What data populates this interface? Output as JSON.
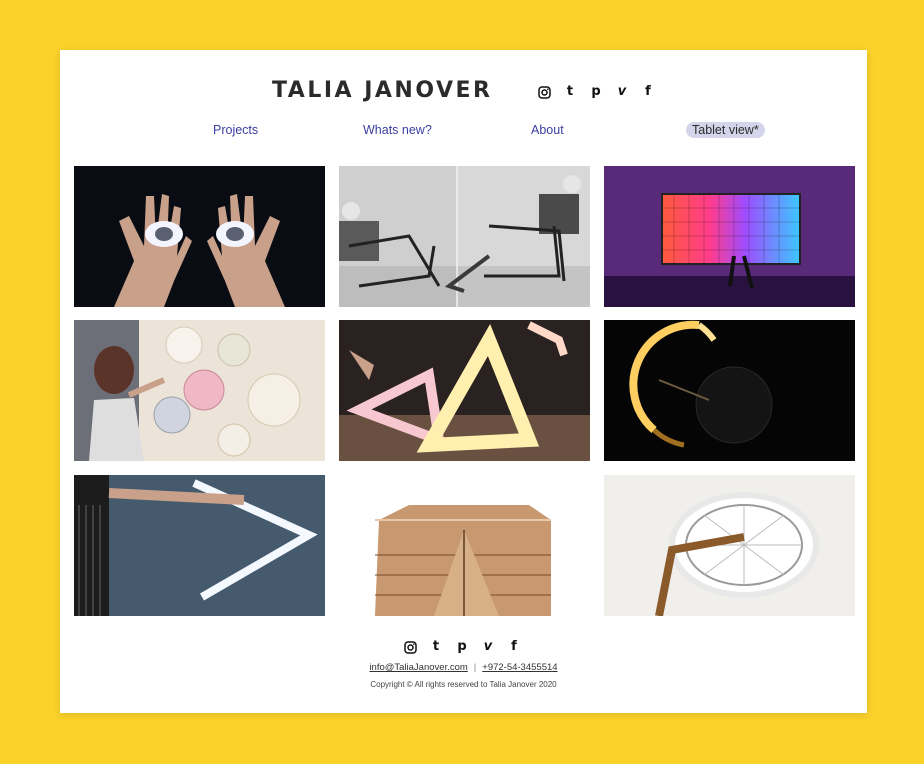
{
  "header": {
    "title": "TALIA JANOVER"
  },
  "social": {
    "icons": [
      "instagram-icon",
      "tumblr-icon",
      "pinterest-icon",
      "vimeo-icon",
      "facebook-icon"
    ],
    "glyphs": {
      "tumblr": "t",
      "pinterest": "p",
      "vimeo": "v",
      "facebook": "f"
    }
  },
  "nav": {
    "items": [
      {
        "label": "Projects"
      },
      {
        "label": "Whats new?"
      },
      {
        "label": "About"
      },
      {
        "label": "Tablet view*"
      }
    ]
  },
  "gallery": {
    "items": [
      {
        "name": "glowing-eyes-hands"
      },
      {
        "name": "masked-chair-photos"
      },
      {
        "name": "led-pixel-wall"
      },
      {
        "name": "woman-plates-wall"
      },
      {
        "name": "glowing-triangles"
      },
      {
        "name": "glowing-ring-dark"
      },
      {
        "name": "light-v-sculpture"
      },
      {
        "name": "wooden-block"
      },
      {
        "name": "bicycle-wheel-lamp"
      }
    ]
  },
  "footer": {
    "email": "info@TaliaJanover.com",
    "separator": "|",
    "phone": "+972-54-3455514",
    "copyright": "Copyright © All rights reserved to Talia Janover 2020"
  },
  "colors": {
    "background": "#fbd22a",
    "page": "#ffffff",
    "nav_link": "#3b3fa0",
    "nav_active_bg": "#d4d4ea"
  }
}
